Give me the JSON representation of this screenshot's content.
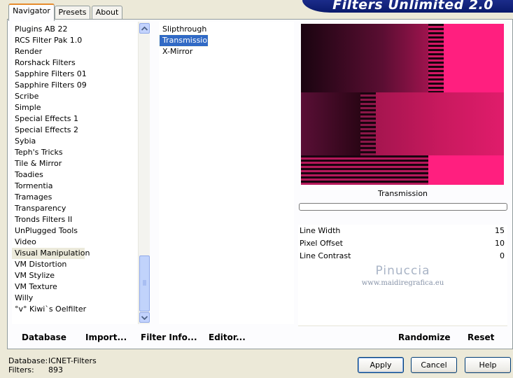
{
  "tabs": [
    {
      "label": "Navigator",
      "active": true
    },
    {
      "label": "Presets",
      "active": false
    },
    {
      "label": "About",
      "active": false
    }
  ],
  "banner_title": "Filters Unlimited 2.0",
  "categories": [
    "Plugins AB 22",
    "RCS Filter Pak 1.0",
    "Render",
    "Rorshack Filters",
    "Sapphire Filters 01",
    "Sapphire Filters 09",
    "Scribe",
    "Simple",
    "Special Effects 1",
    "Special Effects 2",
    "Sybia",
    "Teph's Tricks",
    "Tile & Mirror",
    "Toadies",
    "Tormentia",
    "Tramages",
    "Transparency",
    "Tronds Filters II",
    "UnPlugged Tools",
    "Video",
    "Visual Manipulation",
    "VM Distortion",
    "VM Stylize",
    "VM Texture",
    "Willy",
    "°v° Kiwi`s Oelfilter"
  ],
  "selected_category": "Visual Manipulation",
  "filters": [
    "Slipthrough",
    "Transmission",
    "X-Mirror"
  ],
  "selected_filter": "Transmission",
  "preview_label": "Transmission",
  "parameters": [
    {
      "label": "Line Width",
      "value": "15"
    },
    {
      "label": "Pixel Offset",
      "value": "10"
    },
    {
      "label": "Line Contrast",
      "value": "0"
    }
  ],
  "watermark": {
    "name": "Pinuccia",
    "url": "www.maidiregrafica.eu"
  },
  "left_buttons": {
    "database": "Database",
    "import": "Import...",
    "filter_info": "Filter Info...",
    "editor": "Editor..."
  },
  "right_buttons": {
    "randomize": "Randomize",
    "reset": "Reset"
  },
  "status": {
    "database_label": "Database:",
    "database_value": "ICNET-Filters",
    "filters_label": "Filters:",
    "filters_value": "893"
  },
  "dialog_buttons": {
    "apply": "Apply",
    "cancel": "Cancel",
    "help": "Help"
  },
  "colors": {
    "accent_pink": "#ff1f7f",
    "dark": "#1a0410",
    "selection": "#316ac5"
  }
}
